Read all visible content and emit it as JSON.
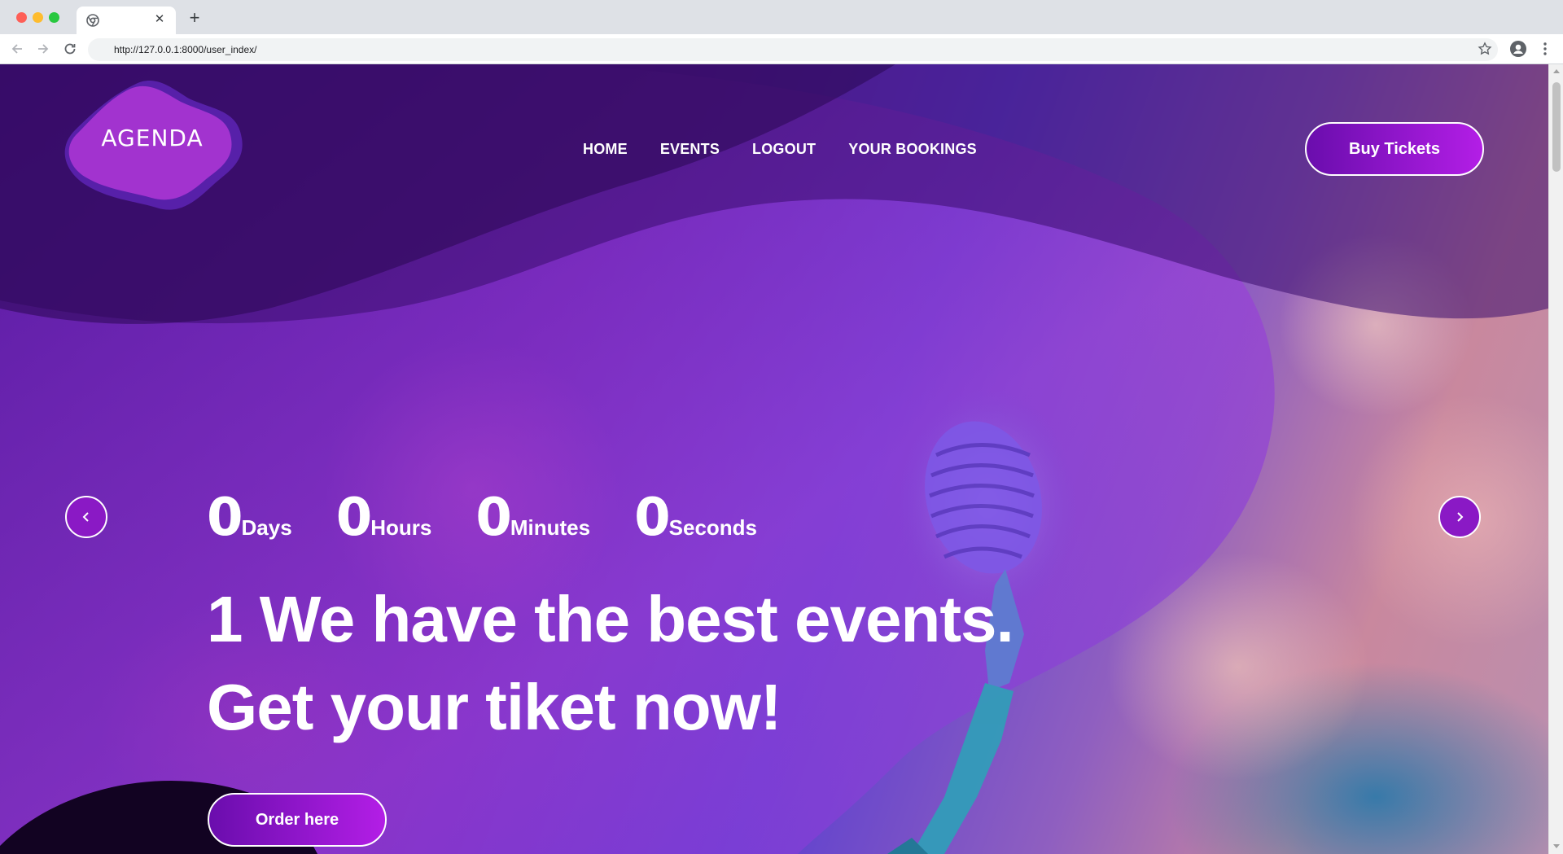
{
  "browser": {
    "url": "http://127.0.0.1:8000/user_index/",
    "tab_close": "✕",
    "new_tab": "+"
  },
  "site": {
    "logo_text": "AGENDA",
    "nav": [
      "HOME",
      "EVENTS",
      "LOGOUT",
      "YOUR BOOKINGS"
    ],
    "buy_tickets": "Buy Tickets"
  },
  "hero": {
    "countdown": [
      {
        "value": "0",
        "unit": "Days"
      },
      {
        "value": "0",
        "unit": "Hours"
      },
      {
        "value": "0",
        "unit": "Minutes"
      },
      {
        "value": "0",
        "unit": "Seconds"
      }
    ],
    "title_line1": "1 We have the best events.",
    "title_line2": "Get your tiket now!",
    "order_button": "Order here"
  },
  "colors": {
    "accent_purple": "#8a19c5",
    "button_gradient_start": "#6a0dad",
    "button_gradient_end": "#b31ee6"
  },
  "icons": {
    "back": "arrow-left-icon",
    "forward": "arrow-right-icon",
    "reload": "reload-icon",
    "bookmark": "star-icon",
    "profile": "profile-icon",
    "menu": "kebab-menu-icon",
    "carousel_prev": "chevron-left-icon",
    "carousel_next": "chevron-right-icon"
  }
}
